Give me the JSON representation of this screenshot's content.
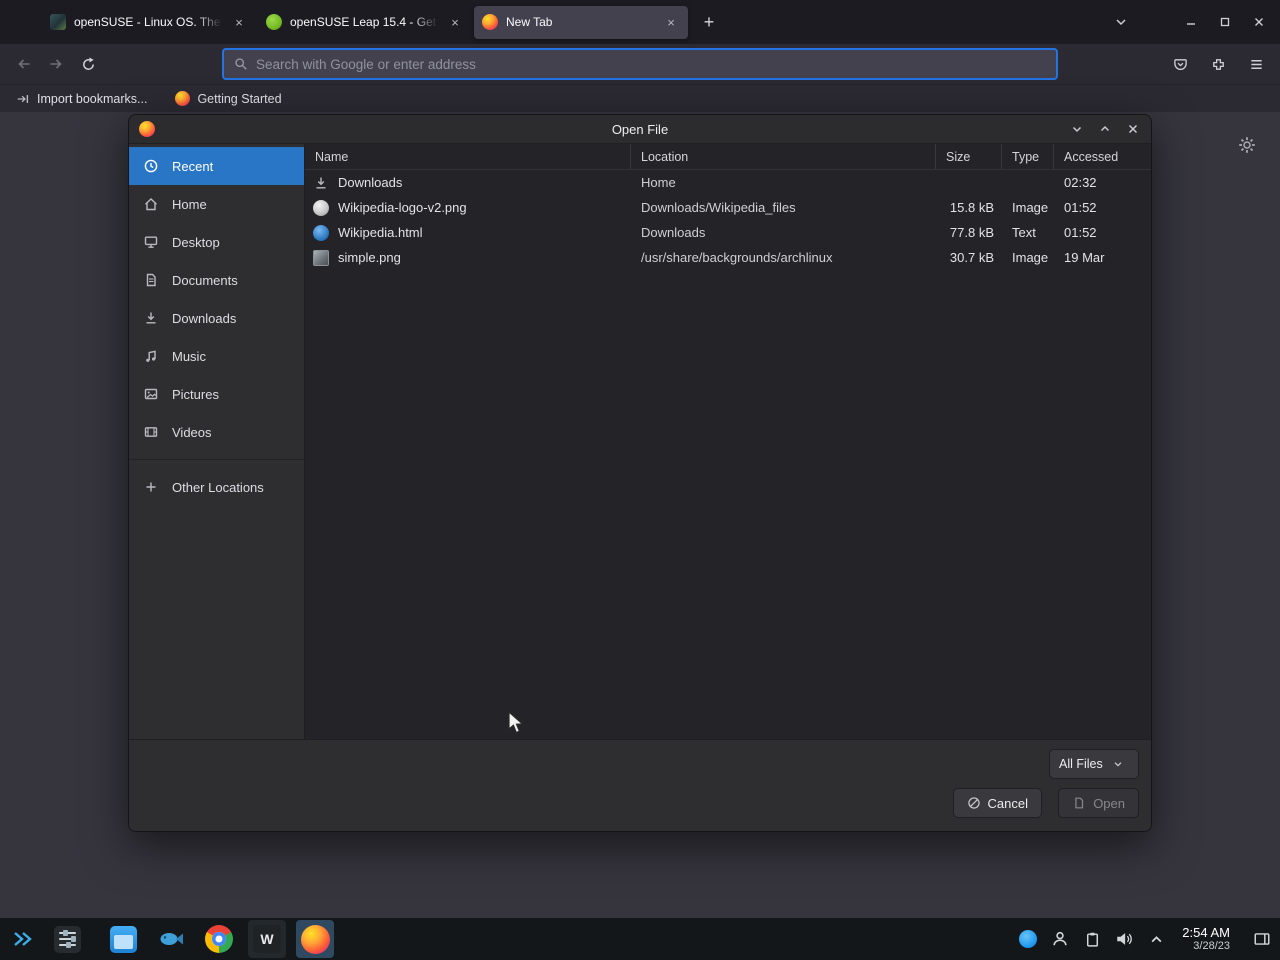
{
  "colors": {
    "sidebar_selected_blue": "#2a76c6",
    "urlbar_focus_border": "#2374e1",
    "active_tab_bg": "#42414d"
  },
  "browser": {
    "tabs": [
      {
        "title": "openSUSE - Linux OS. The"
      },
      {
        "title": "openSUSE Leap 15.4 - Get"
      },
      {
        "title": "New Tab"
      }
    ],
    "new_tab_button": "+",
    "urlbar": {
      "placeholder": "Search with Google or enter address",
      "value": ""
    },
    "bookmarks_bar": {
      "items": [
        {
          "label": "Import bookmarks..."
        },
        {
          "label": "Getting Started"
        }
      ]
    }
  },
  "dialog": {
    "title": "Open File",
    "sidebar": {
      "items": [
        {
          "label": "Recent",
          "selected": true
        },
        {
          "label": "Home"
        },
        {
          "label": "Desktop"
        },
        {
          "label": "Documents"
        },
        {
          "label": "Downloads"
        },
        {
          "label": "Music"
        },
        {
          "label": "Pictures"
        },
        {
          "label": "Videos"
        }
      ],
      "other_locations": "Other Locations"
    },
    "list": {
      "columns": [
        "Name",
        "Location",
        "Size",
        "Type",
        "Accessed"
      ],
      "rows": [
        {
          "name": "Downloads",
          "location": "Home",
          "size": "",
          "type": "",
          "accessed": "02:32"
        },
        {
          "name": "Wikipedia-logo-v2.png",
          "location": "Downloads/Wikipedia_files",
          "size": "15.8 kB",
          "type": "Image",
          "accessed": "01:52"
        },
        {
          "name": "Wikipedia.html",
          "location": "Downloads",
          "size": "77.8 kB",
          "type": "Text",
          "accessed": "01:52"
        },
        {
          "name": "simple.png",
          "location": "/usr/share/backgrounds/archlinux",
          "size": "30.7 kB",
          "type": "Image",
          "accessed": "19 Mar"
        }
      ]
    },
    "footer": {
      "filter_value": "All Files",
      "cancel_label": "Cancel",
      "open_label": "Open"
    }
  },
  "taskbar": {
    "clock": {
      "time": "2:54 AM",
      "date": "3/28/23"
    }
  }
}
